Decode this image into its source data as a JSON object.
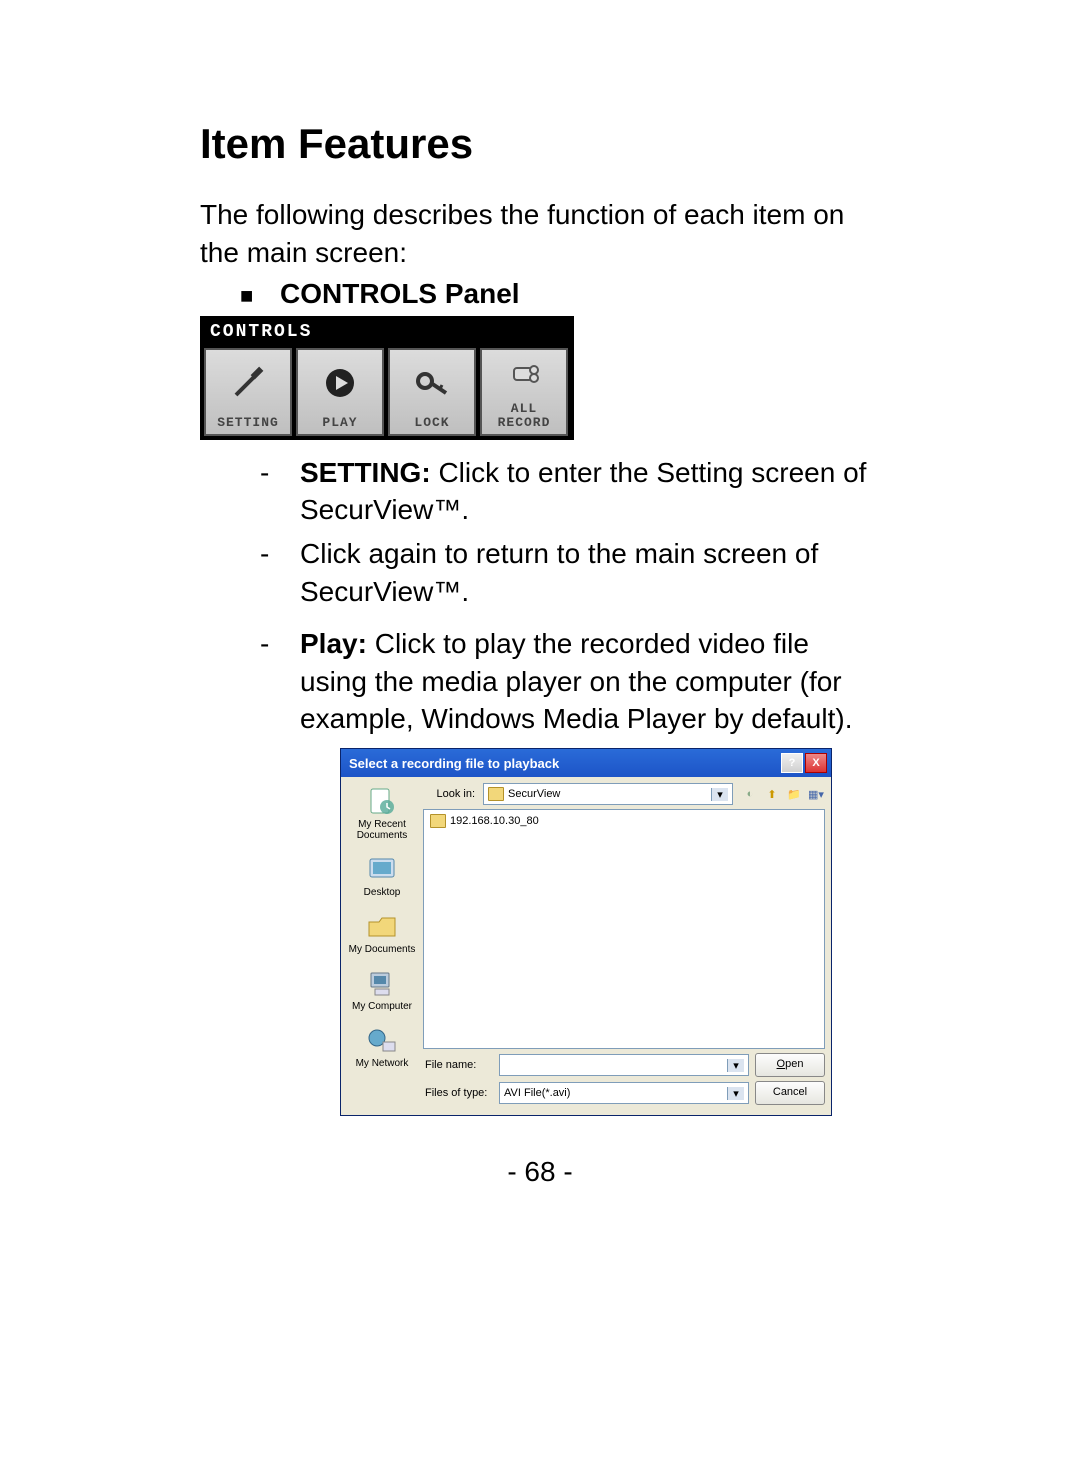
{
  "heading": "Item Features",
  "intro": "The following describes the function of each item on the main screen:",
  "section_bullet": "■",
  "section_title": "CONTROLS Panel",
  "controls": {
    "title": "CONTROLS",
    "buttons": [
      {
        "label": "SETTING",
        "icon": "screwdriver-icon"
      },
      {
        "label": "PLAY",
        "icon": "play-icon"
      },
      {
        "label": "LOCK",
        "icon": "key-icon"
      },
      {
        "label": "ALL RECORD",
        "icon": "camera-icon"
      }
    ]
  },
  "descriptions": {
    "setting_label": "SETTING:",
    "setting_text": "  Click to enter the Setting screen of SecurView™.",
    "setting_note": "Click again to return to the main screen of SecurView™.",
    "play_label": "Play:",
    "play_text": "  Click to play the recorded video file using the media player on the computer (for example, Windows Media Player by default)."
  },
  "dialog": {
    "title": "Select a recording file to playback",
    "help": "?",
    "close": "X",
    "lookin_label": "Look in:",
    "lookin_value": "SecurView",
    "file_entry": "192.168.10.30_80",
    "places": {
      "recent": "My Recent Documents",
      "desktop": "Desktop",
      "mydocs": "My Documents",
      "mycomp": "My Computer",
      "mynet": "My Network"
    },
    "filename_label": "File name:",
    "filename_value": "",
    "filetype_label": "Files of type:",
    "filetype_value": "AVI File(*.avi)",
    "open_btn": "Open",
    "cancel_btn": "Cancel"
  },
  "page_number": "- 68 -"
}
